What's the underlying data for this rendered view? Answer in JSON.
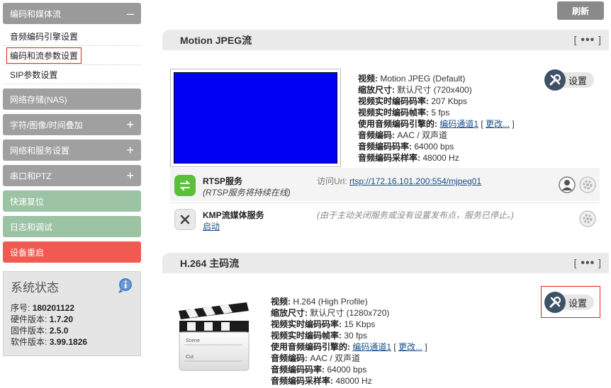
{
  "sidebar": {
    "sections": [
      {
        "label": "编码和媒体流",
        "sign": "–",
        "style": "gray"
      },
      {
        "label": "网络存储(NAS)",
        "sign": "",
        "style": "dark"
      },
      {
        "label": "字符/图像/时间叠加",
        "sign": "+",
        "style": "dark"
      },
      {
        "label": "网络和服务设置",
        "sign": "+",
        "style": "dark"
      },
      {
        "label": "串口和PTZ",
        "sign": "+",
        "style": "dark"
      },
      {
        "label": "快速复位",
        "sign": "",
        "style": "green"
      },
      {
        "label": "日志和调试",
        "sign": "",
        "style": "green"
      },
      {
        "label": "设备重启",
        "sign": "",
        "style": "red"
      }
    ],
    "sub_items": [
      {
        "label": "音频编码引擎设置"
      },
      {
        "label": "编码和流参数设置"
      },
      {
        "label": "SIP参数设置"
      }
    ],
    "status": {
      "title": "系统状态",
      "rows": [
        {
          "k": "序号:",
          "v": "180201122"
        },
        {
          "k": "硬件版本:",
          "v": "1.7.20"
        },
        {
          "k": "固件版本:",
          "v": "2.5.0"
        },
        {
          "k": "软件版本:",
          "v": "3.99.1826"
        }
      ]
    }
  },
  "toolbar": {
    "refresh_label": "刷新"
  },
  "mjpeg": {
    "title": "Motion JPEG流",
    "more": "•••",
    "video": {
      "k": "视频:",
      "v": "Motion JPEG (Default)"
    },
    "scale": {
      "k": "缩放尺寸:",
      "v": "默认尺寸 (720x400)"
    },
    "bitrate": {
      "k": "视频实时编码码率:",
      "v": "207 Kbps"
    },
    "fps": {
      "k": "视频实时编码帧率:",
      "v": "5 fps"
    },
    "audio_engine": {
      "k": "使用音频编码引擎的:",
      "v": "编码通道1",
      "pre": "[",
      "change": "更改...",
      "post": "]"
    },
    "audio_codec": {
      "k": "音频编码:",
      "v": "AAC / 双声道"
    },
    "audio_bitrate": {
      "k": "音频编码码率:",
      "v": "64000 bps"
    },
    "audio_rate": {
      "k": "音频编码采样率:",
      "v": "48000 Hz"
    },
    "settings_label": "设置",
    "rtsp": {
      "name": "RTSP服务",
      "sub": "(RTSP服务将持续在线)",
      "url_label": "访问Url:",
      "url": "rtsp://172.16.101.200:554/mjpeg01"
    },
    "kmp": {
      "name": "KMP流媒体服务",
      "action": "启动",
      "note": "(由于主动关闭服务或没有设置发布点，服务已停止。)"
    }
  },
  "h264": {
    "title": "H.264 主码流",
    "more": "•••",
    "video": {
      "k": "视频:",
      "v": "H.264 (High Profile)"
    },
    "scale": {
      "k": "缩放尺寸:",
      "v": "默认尺寸 (1280x720)"
    },
    "bitrate": {
      "k": "视频实时编码码率:",
      "v": "15 Kbps"
    },
    "fps": {
      "k": "视频实时编码帧率:",
      "v": "30 fps"
    },
    "audio_engine": {
      "k": "使用音频编码引擎的:",
      "v": "编码通道1",
      "pre": "[",
      "change": "更改...",
      "post": "]"
    },
    "audio_codec": {
      "k": "音频编码:",
      "v": "AAC / 双声道"
    },
    "audio_bitrate": {
      "k": "音频编码码率:",
      "v": "64000 bps"
    },
    "audio_rate": {
      "k": "音频编码采样率:",
      "v": "48000 Hz"
    },
    "settings_label": "设置",
    "clapper_scene": "Scene",
    "clapper_cut": "Cut"
  },
  "colors": {
    "accent_red": "#dd2222",
    "preview_blue": "#0000f5",
    "gear_bg": "#3e5166"
  }
}
